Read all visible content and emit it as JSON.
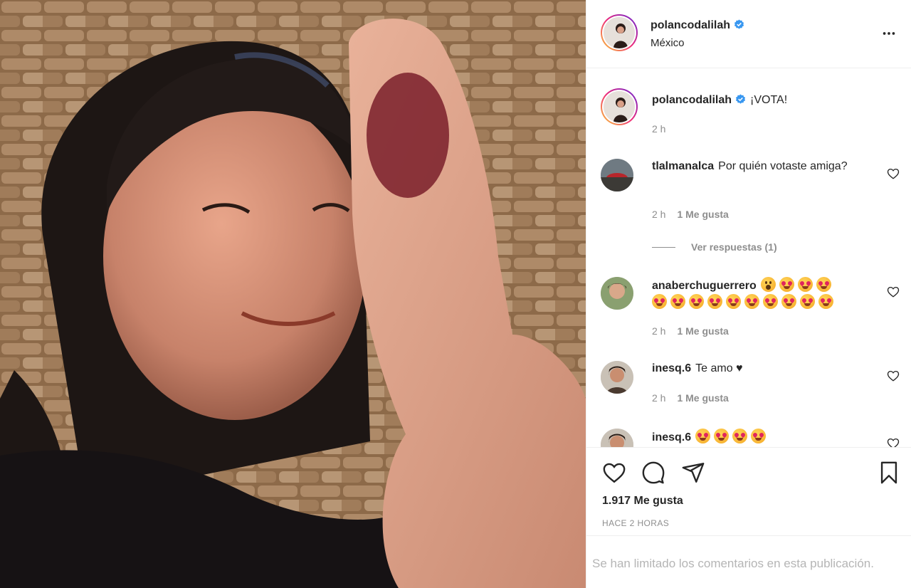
{
  "post": {
    "username": "polancodalilah",
    "location": "México",
    "caption": "¡VOTA!",
    "caption_time": "2 h",
    "likes_count": "1.917 Me gusta",
    "time_ago": "HACE 2 HORAS",
    "comments_limited": "Se han limitado los comentarios en esta publicación."
  },
  "comments": [
    {
      "username": "tlalmanalca",
      "text": "Por quién votaste amiga?",
      "time": "2 h",
      "likes": "1 Me gusta",
      "replies": "Ver respuestas (1)"
    },
    {
      "username": "anaberchuguerrero",
      "text": "",
      "time": "2 h",
      "likes": "1 Me gusta"
    },
    {
      "username": "inesq.6",
      "text": "Te amo ♥",
      "time": "2 h",
      "likes": "1 Me gusta"
    },
    {
      "username": "inesq.6",
      "text": ""
    }
  ],
  "colors": {
    "accent_blue": "#3897f0",
    "muted": "#8e8e8e",
    "border": "#efefef"
  },
  "icons": [
    "verified-badge-icon",
    "more-options-icon",
    "heart-icon",
    "comment-icon",
    "share-icon",
    "bookmark-icon"
  ]
}
